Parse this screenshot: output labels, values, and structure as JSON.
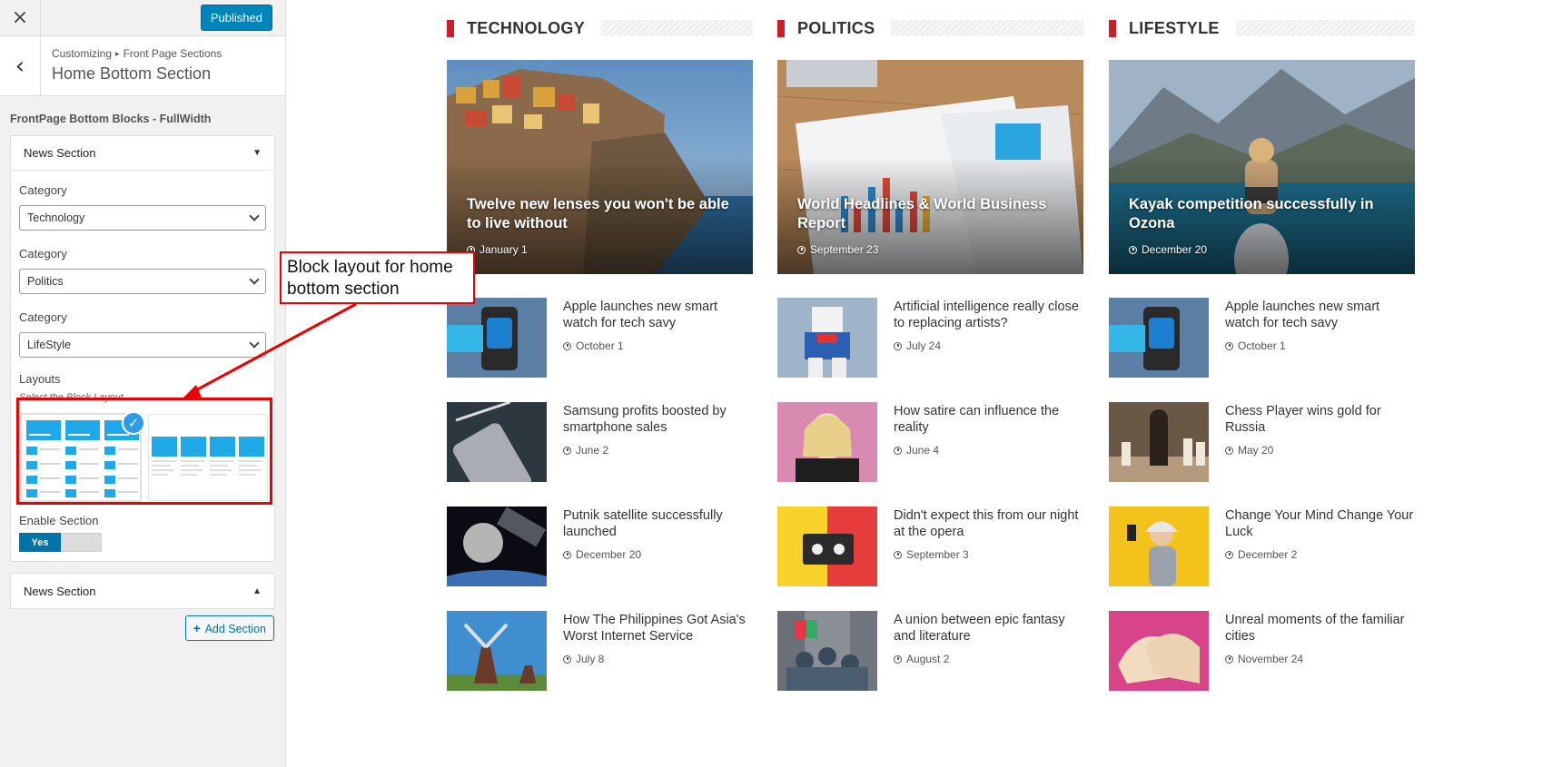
{
  "sidebar": {
    "close_icon": "×",
    "published_label": "Published",
    "back_icon": "‹",
    "breadcrumb": [
      "Customizing",
      "Front Page Sections"
    ],
    "breadcrumb_sep": "▸",
    "section_title": "Home Bottom Section",
    "blocks_title": "FrontPage Bottom Blocks - FullWidth",
    "panel1": {
      "title": "News Section",
      "caret": "▼",
      "category_label": "Category",
      "categories": [
        "Technology",
        "Politics",
        "LifeStyle"
      ],
      "layouts_label": "Layouts",
      "layouts_hint": "Select the Block Layout",
      "enable_label": "Enable Section",
      "enable_value": "Yes"
    },
    "panel2": {
      "title": "News Section",
      "caret": "▲"
    },
    "add_section_label": "Add Section",
    "add_icon": "+"
  },
  "annotation": {
    "text": "Block layout for home bottom section",
    "color": "#ee0000"
  },
  "accent_color": "#c8202a",
  "columns": [
    {
      "title": "TECHNOLOGY",
      "hero": {
        "title": "Twelve new lenses you won't be able to live without",
        "date": "January 1"
      },
      "items": [
        {
          "title": "Apple launches new smart watch for tech savy",
          "date": "October 1"
        },
        {
          "title": "Samsung profits boosted by smartphone sales",
          "date": "June 2"
        },
        {
          "title": "Putnik satellite successfully launched",
          "date": "December 20"
        },
        {
          "title": "How The Philippines Got Asia's Worst Internet Service",
          "date": "July 8"
        }
      ]
    },
    {
      "title": "POLITICS",
      "hero": {
        "title": "World Headlines & World Business Report",
        "date": "September 23"
      },
      "items": [
        {
          "title": "Artificial intelligence really close to replacing artists?",
          "date": "July 24"
        },
        {
          "title": "How satire can influence the reality",
          "date": "June 4"
        },
        {
          "title": "Didn't expect this from our night at the opera",
          "date": "September 3"
        },
        {
          "title": "A union between epic fantasy and literature",
          "date": "August 2"
        }
      ]
    },
    {
      "title": "LIFESTYLE",
      "hero": {
        "title": "Kayak competition successfully in Ozona",
        "date": "December 20"
      },
      "items": [
        {
          "title": "Apple launches new smart watch for tech savy",
          "date": "October 1"
        },
        {
          "title": "Chess Player wins gold for Russia",
          "date": "May 20"
        },
        {
          "title": "Change Your Mind Change Your Luck",
          "date": "December 2"
        },
        {
          "title": "Unreal moments of the familiar cities",
          "date": "November 24"
        }
      ]
    }
  ]
}
